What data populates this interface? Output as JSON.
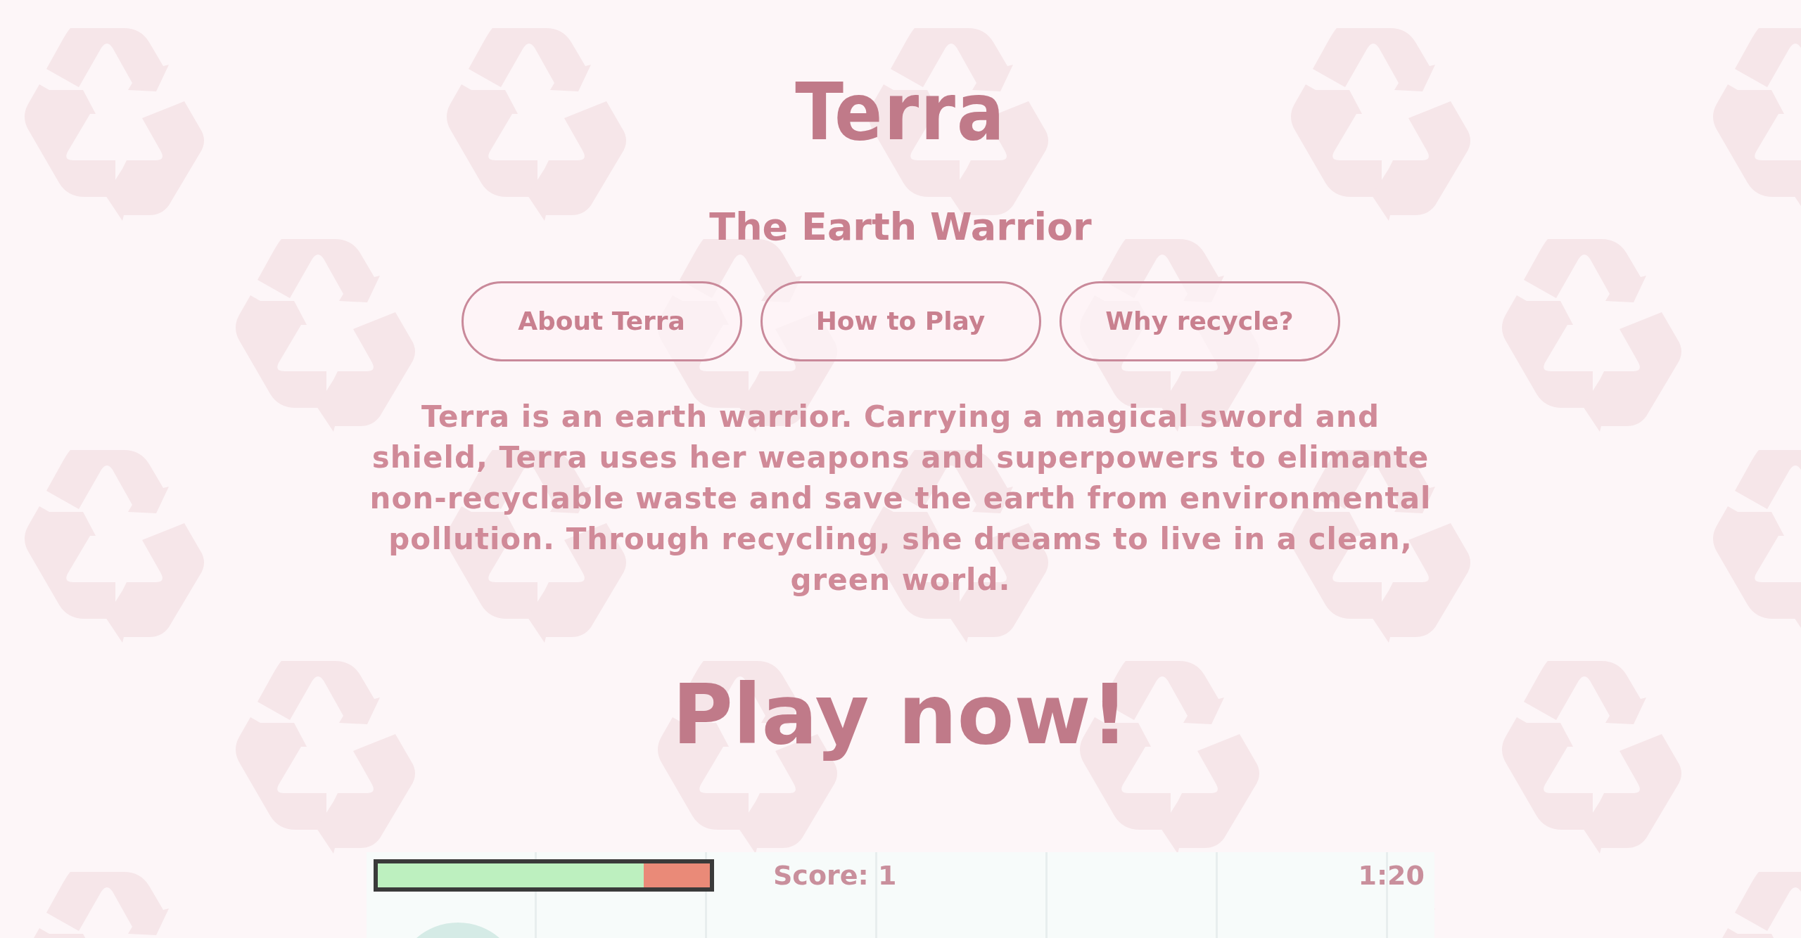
{
  "title": "Terra",
  "subtitle": "The Earth Warrior",
  "nav_buttons": [
    {
      "label": "About Terra"
    },
    {
      "label": "How to Play"
    },
    {
      "label": "Why recycle?"
    }
  ],
  "description": "Terra is an earth warrior. Carrying a magical sword and shield, Terra uses her weapons and superpowers to elimante non-recyclable waste and save the earth from environmental pollution. Through recycling, she dreams to live in a clean, green world.",
  "play_heading": "Play now!",
  "game": {
    "health": {
      "level": 0.8
    },
    "score": "Score: 1",
    "timer": "1:20"
  }
}
